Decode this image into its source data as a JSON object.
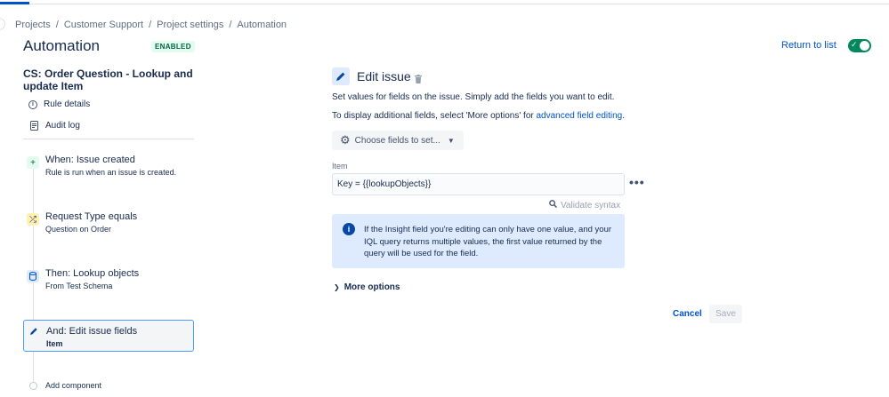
{
  "breadcrumb": [
    "Projects",
    "Customer Support",
    "Project settings",
    "Automation"
  ],
  "header": {
    "title": "Automation",
    "status": "ENABLED",
    "return_link": "Return to list",
    "toggle_on": true
  },
  "sidebar": {
    "rule_name": "CS: Order Question - Lookup and update Item",
    "links": [
      {
        "label": "Rule details",
        "icon": "info-icon"
      },
      {
        "label": "Audit log",
        "icon": "document-icon"
      }
    ],
    "steps": [
      {
        "title": "When: Issue created",
        "sub": "Rule is run when an issue is created.",
        "icon": "plus-icon",
        "color": "#e3fcef"
      },
      {
        "title": "Request Type equals",
        "sub": "Question on Order",
        "icon": "shuffle-icon",
        "color": "#fff0b3"
      },
      {
        "title": "Then: Lookup objects",
        "sub": "From Test Schema",
        "icon": "database-icon",
        "color": "#deebff"
      },
      {
        "title": "And: Edit issue fields",
        "sub": "Item",
        "icon": "pencil-icon",
        "color": "#deebff"
      }
    ],
    "add_component": "Add component"
  },
  "editor": {
    "title": "Edit issue",
    "desc1": "Set values for fields on the issue. Simply add the fields you want to edit.",
    "desc2_prefix": "To display additional fields, select 'More options' for ",
    "desc2_link": "advanced field editing",
    "desc2_suffix": ".",
    "choose_button": "Choose fields to set...",
    "field_label": "Item",
    "field_value": "Key = {{lookupObjects}}",
    "validate": "Validate syntax",
    "info_text": "If the Insight field you're editing can only have one value, and your IQL query returns multiple values, the first value returned by the query will be used for the field.",
    "more_options": "More options",
    "cancel": "Cancel",
    "save": "Save"
  }
}
